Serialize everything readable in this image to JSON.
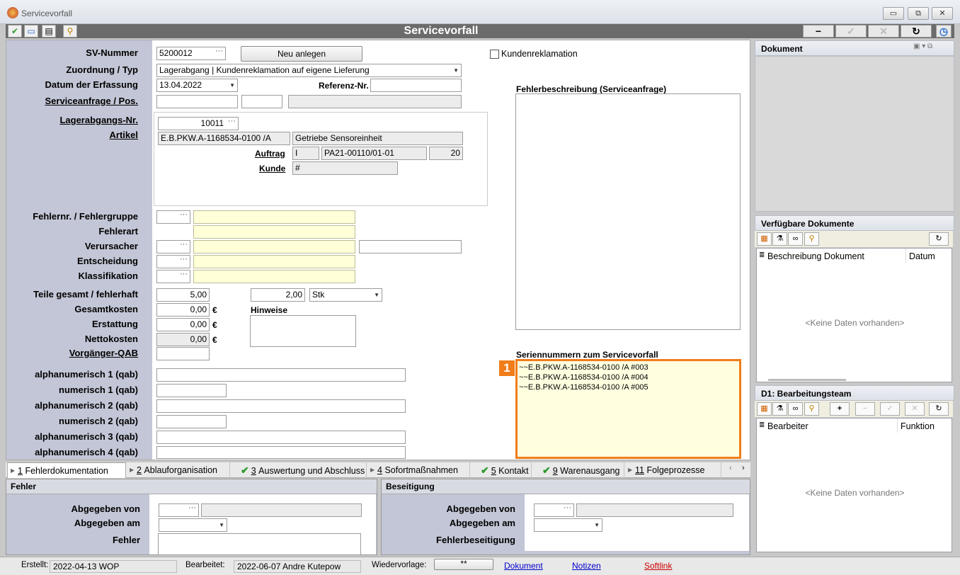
{
  "window": {
    "title": "Servicevorfall",
    "minimize": "▭",
    "restore": "⧉",
    "close": "✕"
  },
  "header": {
    "title": "Servicevorfall",
    "icons": [
      "check-circle-icon",
      "window-icon",
      "document-icon",
      "search-magnifier-icon"
    ],
    "buttons": [
      "minus-icon",
      "check-icon",
      "cross-icon",
      "refresh-icon",
      "clock-icon"
    ]
  },
  "form": {
    "sv_nummer": {
      "label": "SV-Nummer",
      "value": "5200012"
    },
    "neu_anlegen": "Neu anlegen",
    "kundenreklamation": {
      "label": "Kundenreklamation",
      "checked": false
    },
    "zuordnung": {
      "label": "Zuordnung / Typ",
      "value": "Lagerabgang | Kundenreklamation auf eigene Lieferung"
    },
    "datum": {
      "label": "Datum der Erfassung",
      "value": "13.04.2022"
    },
    "referenz": {
      "label": "Referenz-Nr.",
      "value": ""
    },
    "serviceanfrage": {
      "label": "Serviceanfrage / Pos."
    },
    "lagerabgang": {
      "label": "Lagerabgangs-Nr.",
      "value": "10011"
    },
    "artikel": {
      "label": "Artikel",
      "code": "E.B.PKW.A-1168534-0100 /A",
      "name": "Getriebe Sensoreinheit"
    },
    "auftrag": {
      "label": "Auftrag",
      "type": "I",
      "number": "PA21-00110/01-01",
      "pos": "20"
    },
    "kunde": {
      "label": "Kunde",
      "value": "#"
    },
    "fehlernr": {
      "label": "Fehlernr. / Fehlergruppe"
    },
    "fehlerart": {
      "label": "Fehlerart"
    },
    "verursacher": {
      "label": "Verursacher"
    },
    "entscheidung": {
      "label": "Entscheidung"
    },
    "klassifikation": {
      "label": "Klassifikation"
    },
    "teile": {
      "label": "Teile gesamt / fehlerhaft",
      "gesamt": "5,00",
      "fehlerhaft": "2,00",
      "einheit": "Stk"
    },
    "gesamtkosten": {
      "label": "Gesamtkosten",
      "value": "0,00",
      "currency": "€"
    },
    "erstattung": {
      "label": "Erstattung",
      "value": "0,00",
      "currency": "€"
    },
    "nettokosten": {
      "label": "Nettokosten",
      "value": "0,00",
      "currency": "€"
    },
    "vorgaenger": {
      "label": "Vorgänger-QAB"
    },
    "hinweise": {
      "label": "Hinweise"
    },
    "alpha1": {
      "label": "alphanumerisch 1 (qab)"
    },
    "num1": {
      "label": "numerisch 1 (qab)"
    },
    "alpha2": {
      "label": "alphanumerisch 2 (qab)"
    },
    "num2": {
      "label": "numerisch 2 (qab)"
    },
    "alpha3": {
      "label": "alphanumerisch 3 (qab)"
    },
    "alpha4": {
      "label": "alphanumerisch 4 (qab)"
    },
    "fehlerbeschreibung": {
      "label": "Fehlerbeschreibung (Serviceanfrage)"
    },
    "seriennummern": {
      "label": "Seriennummern zum Servicevorfall",
      "badge": "1",
      "items": [
        "~~E.B.PKW.A-1168534-0100 /A #003",
        "~~E.B.PKW.A-1168534-0100 /A #004",
        "~~E.B.PKW.A-1168534-0100 /A #005"
      ]
    }
  },
  "right": {
    "dokument": {
      "title": "Dokument"
    },
    "verfuegbar": {
      "title": "Verfügbare Dokumente",
      "col1": "Beschreibung Dokument",
      "col2": "Datum",
      "empty": "<Keine Daten vorhanden>"
    },
    "team": {
      "title": "D1: Bearbeitungsteam",
      "col1": "Bearbeiter",
      "col2": "Funktion",
      "empty": "<Keine Daten vorhanden>"
    }
  },
  "tabs": [
    {
      "num": "1",
      "label": "Fehlerdokumentation",
      "checked": false,
      "active": true
    },
    {
      "num": "2",
      "label": "Ablauforganisation",
      "checked": false
    },
    {
      "num": "3",
      "label": "Auswertung und Abschluss",
      "checked": true
    },
    {
      "num": "4",
      "label": "Sofortmaßnahmen",
      "checked": false
    },
    {
      "num": "5",
      "label": "Kontakt",
      "checked": true
    },
    {
      "num": "9",
      "label": "Warenausgang",
      "checked": true
    },
    {
      "num": "11",
      "label": "Folgeprozesse",
      "checked": false
    }
  ],
  "fehler": {
    "title": "Fehler",
    "abgegeben_von": "Abgegeben von",
    "abgegeben_am": "Abgegeben am",
    "fehler": "Fehler"
  },
  "beseitigung": {
    "title": "Beseitigung",
    "abgegeben_von": "Abgegeben von",
    "abgegeben_am": "Abgegeben am",
    "fehlerbeseitigung": "Fehlerbeseitigung"
  },
  "status": {
    "erstellt_label": "Erstellt:",
    "erstellt_value": "2022-04-13  WOP",
    "bearbeitet_label": "Bearbeitet:",
    "bearbeitet_value": "2022-06-07  Andre Kutepow",
    "wiedervorlage_label": "Wiedervorlage:",
    "wiedervorlage_value": "**",
    "dokument": "Dokument",
    "notizen": "Notizen",
    "softlink": "Softlink"
  }
}
